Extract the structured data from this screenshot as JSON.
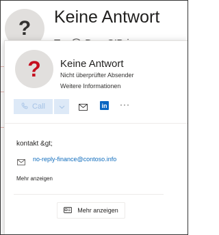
{
  "background": {
    "avatar_glyph": "?",
    "title": "Keine Antwort",
    "to_line": "To: ◯ Dan O'Brien"
  },
  "card": {
    "avatar_glyph": "?",
    "name": "Keine Antwort",
    "unverified_sender": "Nicht überprüfter Absender",
    "more_info": "Weitere Informationen",
    "actions": {
      "call_label": "Call",
      "call_icon": "phone-icon",
      "chevron_icon": "chevron-down-icon",
      "mail_icon": "mail-icon",
      "linkedin_icon": "linkedin-icon",
      "linkedin_glyph": "in",
      "more_icon": "more-icon",
      "more_glyph": "···"
    },
    "company": "kontakt &gt;",
    "email": "no-reply-finance@contoso.info",
    "show_more": "Mehr anzeigen",
    "show_more_button": "Mehr anzeigen"
  },
  "colors": {
    "accent": "#0f6cbd",
    "unverified_avatar": "#c50f1f",
    "call_bg": "#dde9f7",
    "linkedin": "#0a66c2"
  }
}
